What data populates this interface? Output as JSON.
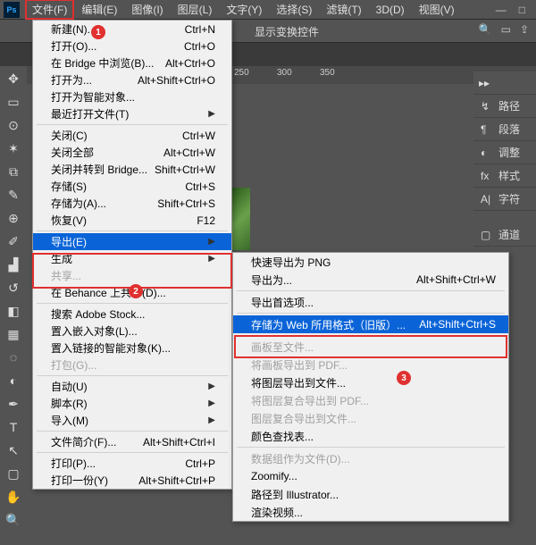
{
  "menubar": {
    "items": [
      "文件(F)",
      "编辑(E)",
      "图像(I)",
      "图层(L)",
      "文字(Y)",
      "选择(S)",
      "滤镜(T)",
      "3D(D)",
      "视图(V)"
    ]
  },
  "toolbar": {
    "transform_label": "显示变换控件"
  },
  "ruler": {
    "t250": "250",
    "t300": "300",
    "t350": "350"
  },
  "panels": {
    "items": [
      {
        "icon": "↯",
        "label": "路径"
      },
      {
        "icon": "¶",
        "label": "段落"
      },
      {
        "icon": "◐",
        "label": "调整"
      },
      {
        "icon": "fx",
        "label": "样式"
      },
      {
        "icon": "A|",
        "label": "字符"
      },
      {
        "icon": "▢",
        "label": "通道"
      }
    ]
  },
  "callouts": {
    "c1": "1",
    "c2": "2",
    "c3": "3"
  },
  "file_menu": [
    {
      "label": "新建(N)...",
      "shortcut": "Ctrl+N"
    },
    {
      "label": "打开(O)...",
      "shortcut": "Ctrl+O"
    },
    {
      "label": "在 Bridge 中浏览(B)...",
      "shortcut": "Alt+Ctrl+O"
    },
    {
      "label": "打开为...",
      "shortcut": "Alt+Shift+Ctrl+O"
    },
    {
      "label": "打开为智能对象..."
    },
    {
      "label": "最近打开文件(T)",
      "submenu": true
    },
    {
      "sep": true
    },
    {
      "label": "关闭(C)",
      "shortcut": "Ctrl+W"
    },
    {
      "label": "关闭全部",
      "shortcut": "Alt+Ctrl+W"
    },
    {
      "label": "关闭并转到 Bridge...",
      "shortcut": "Shift+Ctrl+W"
    },
    {
      "label": "存储(S)",
      "shortcut": "Ctrl+S"
    },
    {
      "label": "存储为(A)...",
      "shortcut": "Shift+Ctrl+S"
    },
    {
      "label": "恢复(V)",
      "shortcut": "F12"
    },
    {
      "sep": true
    },
    {
      "label": "导出(E)",
      "submenu": true,
      "hover": true
    },
    {
      "label": "生成",
      "submenu": true
    },
    {
      "label": "共享...",
      "disabled": true
    },
    {
      "label": "在 Behance 上共享(D)..."
    },
    {
      "sep": true
    },
    {
      "label": "搜索 Adobe Stock..."
    },
    {
      "label": "置入嵌入对象(L)..."
    },
    {
      "label": "置入链接的智能对象(K)..."
    },
    {
      "label": "打包(G)...",
      "disabled": true
    },
    {
      "sep": true
    },
    {
      "label": "自动(U)",
      "submenu": true
    },
    {
      "label": "脚本(R)",
      "submenu": true
    },
    {
      "label": "导入(M)",
      "submenu": true
    },
    {
      "sep": true
    },
    {
      "label": "文件简介(F)...",
      "shortcut": "Alt+Shift+Ctrl+I"
    },
    {
      "sep": true
    },
    {
      "label": "打印(P)...",
      "shortcut": "Ctrl+P"
    },
    {
      "label": "打印一份(Y)",
      "shortcut": "Alt+Shift+Ctrl+P"
    }
  ],
  "export_submenu": [
    {
      "label": "快速导出为 PNG"
    },
    {
      "label": "导出为...",
      "shortcut": "Alt+Shift+Ctrl+W"
    },
    {
      "sep": true
    },
    {
      "label": "导出首选项..."
    },
    {
      "sep": true
    },
    {
      "label": "存储为 Web 所用格式（旧版）...",
      "shortcut": "Alt+Shift+Ctrl+S",
      "hover": true
    },
    {
      "sep": true
    },
    {
      "label": "画板至文件...",
      "disabled": true
    },
    {
      "label": "将画板导出到 PDF...",
      "disabled": true
    },
    {
      "label": "将图层导出到文件..."
    },
    {
      "label": "将图层复合导出到 PDF...",
      "disabled": true
    },
    {
      "label": "图层复合导出到文件...",
      "disabled": true
    },
    {
      "label": "颜色查找表..."
    },
    {
      "sep": true
    },
    {
      "label": "数据组作为文件(D)...",
      "disabled": true
    },
    {
      "label": "Zoomify..."
    },
    {
      "label": "路径到 Illustrator..."
    },
    {
      "label": "渲染视频..."
    }
  ]
}
